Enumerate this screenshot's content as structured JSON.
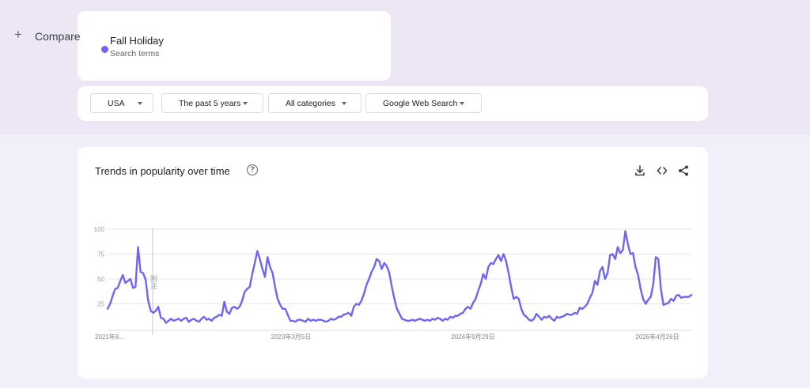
{
  "search_term": {
    "name": "Fall Holiday",
    "subtitle": "Search terms",
    "color": "#6f65f5"
  },
  "compare": {
    "plus": "+",
    "label": "Compare"
  },
  "filters": [
    {
      "label": "USA",
      "icon": "caret-down-icon"
    },
    {
      "label": "The past 5 years",
      "icon": "caret-down-icon"
    },
    {
      "label": "All categories",
      "icon": "caret-down-icon"
    },
    {
      "label": "Google Web Search",
      "icon": "caret-down-icon"
    }
  ],
  "chart_panel": {
    "title": "Trends in popularity over time",
    "help_icon": "help-icon",
    "help_glyph": "?",
    "tools": [
      "download-icon",
      "embed-code-icon",
      "share-icon"
    ],
    "note_marker": "附注"
  },
  "chart_data": {
    "type": "line",
    "title": "",
    "xlabel": "",
    "ylabel": "",
    "ylim": [
      0,
      100
    ],
    "yticks": [
      25,
      50,
      75,
      100
    ],
    "grid": true,
    "legend": "none",
    "x_tick_labels": [
      "2021年8...",
      "2023年3月5日",
      "2024年9月29日",
      "2026年4月26日"
    ],
    "series": [
      {
        "color": "#6f65f5",
        "values": [
          20,
          25,
          33,
          40,
          41,
          48,
          54,
          46,
          48,
          50,
          41,
          42,
          82,
          57,
          56,
          49,
          28,
          18,
          16,
          18,
          22,
          11,
          10,
          6,
          8,
          10,
          8,
          9,
          10,
          8,
          10,
          11,
          7,
          9,
          10,
          8,
          7,
          10,
          12,
          9,
          10,
          8,
          11,
          12,
          14,
          13,
          27,
          17,
          15,
          21,
          22,
          20,
          22,
          28,
          37,
          40,
          42,
          55,
          66,
          78,
          70,
          60,
          52,
          72,
          62,
          56,
          42,
          30,
          24,
          20,
          20,
          14,
          8,
          8,
          7,
          9,
          9,
          8,
          7,
          10,
          8,
          9,
          8,
          9,
          9,
          8,
          7,
          8,
          10,
          9,
          10,
          12,
          12,
          14,
          15,
          16,
          13,
          22,
          25,
          24,
          28,
          35,
          44,
          50,
          57,
          62,
          70,
          68,
          60,
          66,
          63,
          56,
          42,
          30,
          20,
          15,
          10,
          9,
          8,
          8,
          9,
          8,
          9,
          10,
          9,
          8,
          9,
          8,
          10,
          9,
          11,
          10,
          8,
          10,
          9,
          12,
          11,
          13,
          13,
          15,
          16,
          20,
          22,
          20,
          26,
          30,
          38,
          45,
          55,
          50,
          62,
          66,
          65,
          70,
          74,
          68,
          75,
          68,
          56,
          42,
          30,
          32,
          30,
          20,
          14,
          12,
          9,
          8,
          10,
          15,
          12,
          9,
          12,
          11,
          13,
          10,
          8,
          12,
          11,
          12,
          13,
          15,
          14,
          14,
          16,
          15,
          21,
          20,
          22,
          25,
          31,
          36,
          48,
          44,
          58,
          62,
          50,
          56,
          74,
          75,
          70,
          82,
          76,
          79,
          98,
          85,
          75,
          76,
          62,
          54,
          40,
          30,
          25,
          29,
          32,
          45,
          72,
          70,
          40,
          24,
          25,
          26,
          30,
          28,
          33,
          34,
          31,
          32,
          32,
          32,
          34
        ]
      }
    ]
  }
}
